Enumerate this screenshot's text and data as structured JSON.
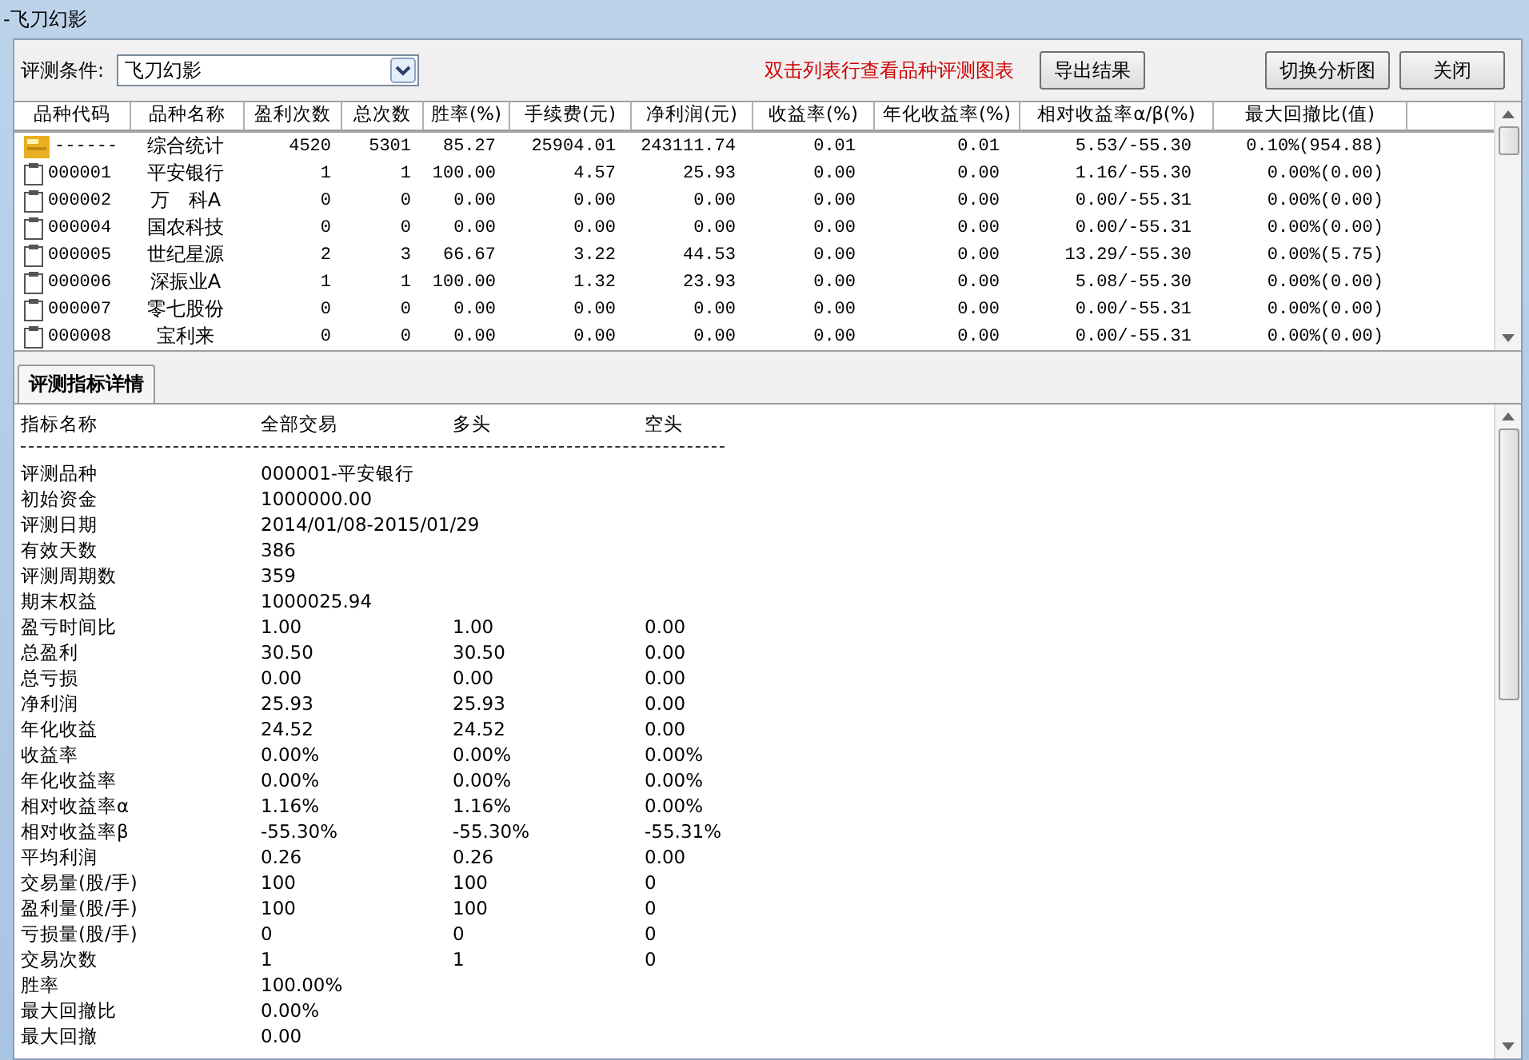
{
  "window": {
    "title": "-飞刀幻影"
  },
  "toolbar": {
    "condition_label": "评测条件:",
    "condition_value": "飞刀幻影",
    "hint": "双击列表行查看品种评测图表",
    "buttons_left": [
      "导出结果"
    ],
    "buttons_right": [
      "切换分析图",
      "关闭"
    ]
  },
  "table": {
    "columns": [
      "品种代码",
      "品种名称",
      "盈利次数",
      "总次数",
      "胜率(%)",
      "手续费(元)",
      "净利润(元)",
      "收益率(%)",
      "年化收益率(%)",
      "相对收益率α/β(%)",
      "最大回撤比(值)"
    ],
    "rows": [
      {
        "kind": "summary",
        "cells": [
          "------",
          "综合统计",
          "4520",
          "5301",
          "85.27",
          "25904.01",
          "243111.74",
          "0.01",
          "0.01",
          "5.53/-55.30",
          "0.10%(954.88)"
        ]
      },
      {
        "kind": "stock",
        "cells": [
          "000001",
          "平安银行",
          "1",
          "1",
          "100.00",
          "4.57",
          "25.93",
          "0.00",
          "0.00",
          "1.16/-55.30",
          "0.00%(0.00)"
        ]
      },
      {
        "kind": "stock",
        "cells": [
          "000002",
          "万　科A",
          "0",
          "0",
          "0.00",
          "0.00",
          "0.00",
          "0.00",
          "0.00",
          "0.00/-55.31",
          "0.00%(0.00)"
        ]
      },
      {
        "kind": "stock",
        "cells": [
          "000004",
          "国农科技",
          "0",
          "0",
          "0.00",
          "0.00",
          "0.00",
          "0.00",
          "0.00",
          "0.00/-55.31",
          "0.00%(0.00)"
        ]
      },
      {
        "kind": "stock",
        "cells": [
          "000005",
          "世纪星源",
          "2",
          "3",
          "66.67",
          "3.22",
          "44.53",
          "0.00",
          "0.00",
          "13.29/-55.30",
          "0.00%(5.75)"
        ]
      },
      {
        "kind": "stock",
        "cells": [
          "000006",
          "深振业A",
          "1",
          "1",
          "100.00",
          "1.32",
          "23.93",
          "0.00",
          "0.00",
          "5.08/-55.30",
          "0.00%(0.00)"
        ]
      },
      {
        "kind": "stock",
        "cells": [
          "000007",
          "零七股份",
          "0",
          "0",
          "0.00",
          "0.00",
          "0.00",
          "0.00",
          "0.00",
          "0.00/-55.31",
          "0.00%(0.00)"
        ]
      },
      {
        "kind": "stock",
        "cells": [
          "000008",
          "宝利来",
          "0",
          "0",
          "0.00",
          "0.00",
          "0.00",
          "0.00",
          "0.00",
          "0.00/-55.31",
          "0.00%(0.00)"
        ]
      }
    ]
  },
  "tabs": [
    {
      "label": "评测指标详情",
      "selected": true
    }
  ],
  "details": {
    "columns": [
      "指标名称",
      "全部交易",
      "多头",
      "空头"
    ],
    "rows": [
      [
        "评测品种",
        "000001-平安银行"
      ],
      [
        "初始资金",
        "1000000.00"
      ],
      [
        "评测日期",
        "2014/01/08-2015/01/29"
      ],
      [
        "有效天数",
        "386"
      ],
      [
        "评测周期数",
        "359"
      ],
      [
        "期末权益",
        "1000025.94"
      ],
      [
        "盈亏时间比",
        "1.00",
        "1.00",
        "0.00"
      ],
      [
        "总盈利",
        "30.50",
        "30.50",
        "0.00"
      ],
      [
        "总亏损",
        "0.00",
        "0.00",
        "0.00"
      ],
      [
        "净利润",
        "25.93",
        "25.93",
        "0.00"
      ],
      [
        "年化收益",
        "24.52",
        "24.52",
        "0.00"
      ],
      [
        "收益率",
        "0.00%",
        "0.00%",
        "0.00%"
      ],
      [
        "年化收益率",
        "0.00%",
        "0.00%",
        "0.00%"
      ],
      [
        "相对收益率α",
        "1.16%",
        "1.16%",
        "0.00%"
      ],
      [
        "相对收益率β",
        "-55.30%",
        "-55.30%",
        "-55.31%"
      ],
      [
        "平均利润",
        "0.26",
        "0.26",
        "0.00"
      ],
      [
        "交易量(股/手)",
        "100",
        "100",
        "0"
      ],
      [
        "盈利量(股/手)",
        "100",
        "100",
        "0"
      ],
      [
        "亏损量(股/手)",
        "0",
        "0",
        "0"
      ],
      [
        "交易次数",
        "1",
        "1",
        "0"
      ],
      [
        "胜率",
        "100.00%"
      ],
      [
        "最大回撤比",
        "0.00%"
      ],
      [
        "最大回撤",
        "0.00"
      ]
    ]
  }
}
